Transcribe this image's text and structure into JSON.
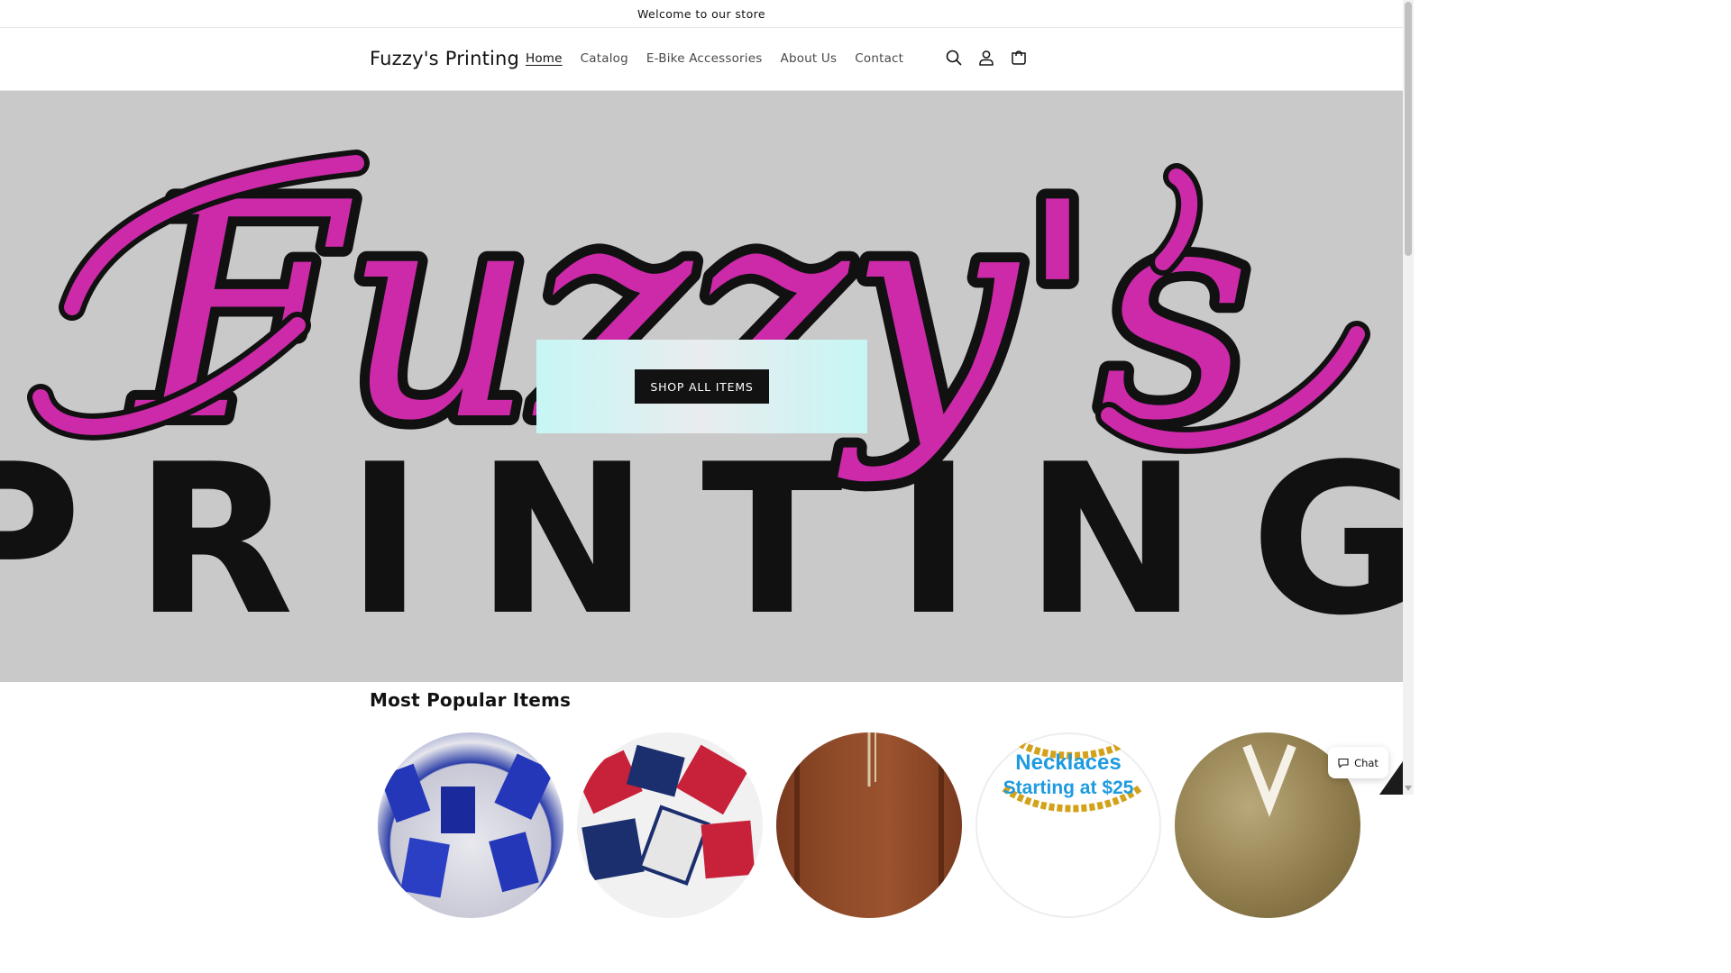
{
  "announcement": {
    "text": "Welcome to our store"
  },
  "header": {
    "logo": "Fuzzy's Printing",
    "nav": [
      {
        "label": "Home",
        "active": true
      },
      {
        "label": "Catalog",
        "active": false
      },
      {
        "label": "E-Bike Accessories",
        "active": false
      },
      {
        "label": "About Us",
        "active": false
      },
      {
        "label": "Contact",
        "active": false
      }
    ],
    "icons": [
      "search-icon",
      "account-icon",
      "cart-icon"
    ]
  },
  "hero": {
    "banner_script_text": "Fuzzy's",
    "banner_block_text": "PRINTING",
    "button_label": "SHOP ALL ITEMS",
    "colors": {
      "background": "#c9c9c9",
      "script": "#cc2aa8",
      "outline": "#111111",
      "box": "#c6f6f4"
    }
  },
  "popular": {
    "title": "Most Popular Items",
    "items": [
      {
        "name": "product-blue-tags"
      },
      {
        "name": "product-red-tags"
      },
      {
        "name": "product-wood"
      },
      {
        "name": "product-necklaces",
        "text_line1": "Necklaces",
        "text_line2": "Starting at $25"
      },
      {
        "name": "product-tan"
      }
    ]
  },
  "chat": {
    "label": "Chat"
  }
}
